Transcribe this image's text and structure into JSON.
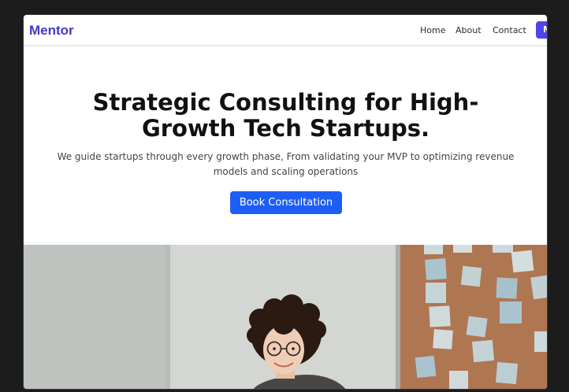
{
  "nav": {
    "brand": "Mentor",
    "links": [
      "Home",
      "About",
      "Contact"
    ],
    "cta_partial": "M"
  },
  "hero": {
    "title": "Strategic Consulting for High-Growth Tech Startups.",
    "subtitle": "We guide startups through every growth phase, From validating your MVP to optimizing revenue models and scaling operations",
    "button_label": "Book Consultation"
  },
  "colors": {
    "brand": "#4338ca",
    "button": "#1d5ef5",
    "nav_cta": "#4f46e5"
  },
  "image": {
    "icon": "hero-photo"
  }
}
